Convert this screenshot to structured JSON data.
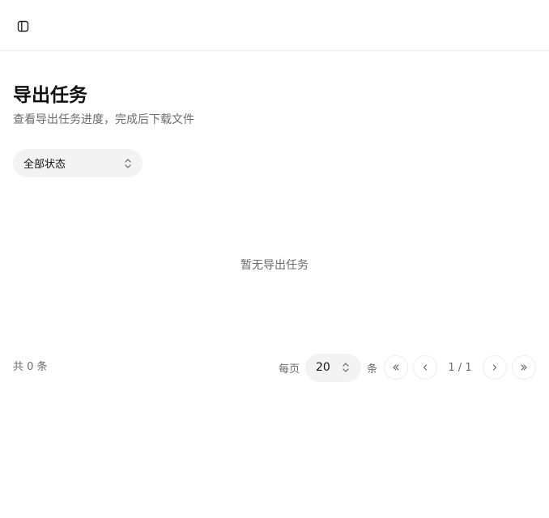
{
  "header": {
    "toggle_icon": "sidebar-toggle-icon"
  },
  "page": {
    "title": "导出任务",
    "subtitle": "查看导出任务进度，完成后下载文件"
  },
  "filter": {
    "status_value": "全部状态",
    "icon": "updown-chevron-icon"
  },
  "empty_state": {
    "message": "暂无导出任务"
  },
  "footer": {
    "total": "共 0 条",
    "per_page_label": "每页",
    "page_size": "20",
    "unit_label": "条",
    "page_indicator": "1 / 1",
    "icons": {
      "first": "chevrons-left-icon",
      "prev": "chevron-left-icon",
      "next": "chevron-right-icon",
      "last": "chevrons-right-icon"
    }
  }
}
